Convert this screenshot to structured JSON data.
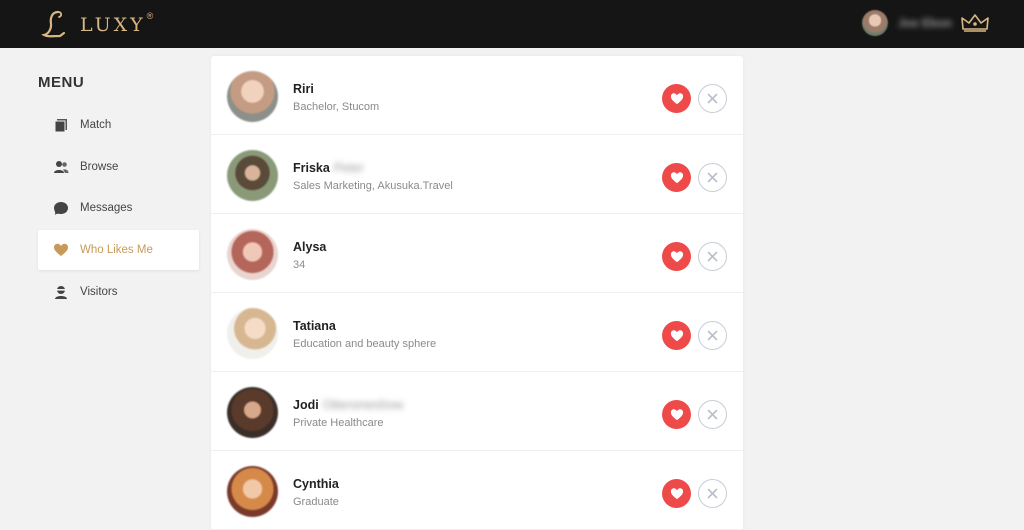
{
  "header": {
    "brand": "LUXY",
    "registered": "®",
    "user_name": "Joe Ebon"
  },
  "menu": {
    "title": "MENU",
    "items": [
      {
        "label": "Match",
        "icon": "cards-icon"
      },
      {
        "label": "Browse",
        "icon": "users-icon"
      },
      {
        "label": "Messages",
        "icon": "chat-bubble-icon"
      },
      {
        "label": "Who Likes Me",
        "icon": "heart-icon",
        "active": true
      },
      {
        "label": "Visitors",
        "icon": "visitor-icon"
      }
    ]
  },
  "likes": [
    {
      "name": "Riri",
      "surname": "",
      "detail": "Bachelor, Stucom"
    },
    {
      "name": "Friska",
      "surname": "Peter",
      "detail": "Sales Marketing, Akusuka.Travel"
    },
    {
      "name": "Alysa",
      "surname": "",
      "detail": "34"
    },
    {
      "name": "Tatiana",
      "surname": "",
      "detail": "Education and beauty sphere"
    },
    {
      "name": "Jodi",
      "surname": "Ottersmeshow",
      "detail": "Private Healthcare"
    },
    {
      "name": "Cynthia",
      "surname": "",
      "detail": "Graduate"
    }
  ],
  "colors": {
    "topbar": "#151515",
    "brand_gold": "#d8b882",
    "accent_active": "#c89a5a",
    "like_red": "#ef4a4a"
  }
}
